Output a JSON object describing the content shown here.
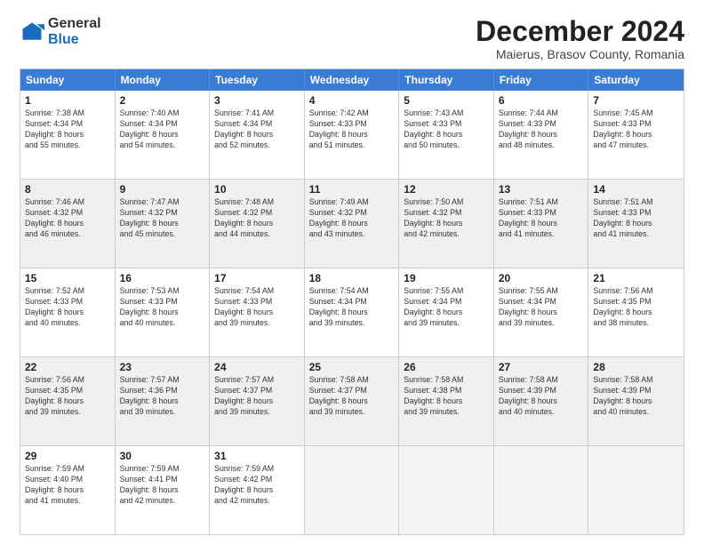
{
  "logo": {
    "general": "General",
    "blue": "Blue"
  },
  "header": {
    "month": "December 2024",
    "location": "Maierus, Brasov County, Romania"
  },
  "days": [
    "Sunday",
    "Monday",
    "Tuesday",
    "Wednesday",
    "Thursday",
    "Friday",
    "Saturday"
  ],
  "rows": [
    [
      {
        "day": "1",
        "lines": [
          "Sunrise: 7:38 AM",
          "Sunset: 4:34 PM",
          "Daylight: 8 hours",
          "and 55 minutes."
        ]
      },
      {
        "day": "2",
        "lines": [
          "Sunrise: 7:40 AM",
          "Sunset: 4:34 PM",
          "Daylight: 8 hours",
          "and 54 minutes."
        ]
      },
      {
        "day": "3",
        "lines": [
          "Sunrise: 7:41 AM",
          "Sunset: 4:34 PM",
          "Daylight: 8 hours",
          "and 52 minutes."
        ]
      },
      {
        "day": "4",
        "lines": [
          "Sunrise: 7:42 AM",
          "Sunset: 4:33 PM",
          "Daylight: 8 hours",
          "and 51 minutes."
        ]
      },
      {
        "day": "5",
        "lines": [
          "Sunrise: 7:43 AM",
          "Sunset: 4:33 PM",
          "Daylight: 8 hours",
          "and 50 minutes."
        ]
      },
      {
        "day": "6",
        "lines": [
          "Sunrise: 7:44 AM",
          "Sunset: 4:33 PM",
          "Daylight: 8 hours",
          "and 48 minutes."
        ]
      },
      {
        "day": "7",
        "lines": [
          "Sunrise: 7:45 AM",
          "Sunset: 4:33 PM",
          "Daylight: 8 hours",
          "and 47 minutes."
        ]
      }
    ],
    [
      {
        "day": "8",
        "lines": [
          "Sunrise: 7:46 AM",
          "Sunset: 4:32 PM",
          "Daylight: 8 hours",
          "and 46 minutes."
        ]
      },
      {
        "day": "9",
        "lines": [
          "Sunrise: 7:47 AM",
          "Sunset: 4:32 PM",
          "Daylight: 8 hours",
          "and 45 minutes."
        ]
      },
      {
        "day": "10",
        "lines": [
          "Sunrise: 7:48 AM",
          "Sunset: 4:32 PM",
          "Daylight: 8 hours",
          "and 44 minutes."
        ]
      },
      {
        "day": "11",
        "lines": [
          "Sunrise: 7:49 AM",
          "Sunset: 4:32 PM",
          "Daylight: 8 hours",
          "and 43 minutes."
        ]
      },
      {
        "day": "12",
        "lines": [
          "Sunrise: 7:50 AM",
          "Sunset: 4:32 PM",
          "Daylight: 8 hours",
          "and 42 minutes."
        ]
      },
      {
        "day": "13",
        "lines": [
          "Sunrise: 7:51 AM",
          "Sunset: 4:33 PM",
          "Daylight: 8 hours",
          "and 41 minutes."
        ]
      },
      {
        "day": "14",
        "lines": [
          "Sunrise: 7:51 AM",
          "Sunset: 4:33 PM",
          "Daylight: 8 hours",
          "and 41 minutes."
        ]
      }
    ],
    [
      {
        "day": "15",
        "lines": [
          "Sunrise: 7:52 AM",
          "Sunset: 4:33 PM",
          "Daylight: 8 hours",
          "and 40 minutes."
        ]
      },
      {
        "day": "16",
        "lines": [
          "Sunrise: 7:53 AM",
          "Sunset: 4:33 PM",
          "Daylight: 8 hours",
          "and 40 minutes."
        ]
      },
      {
        "day": "17",
        "lines": [
          "Sunrise: 7:54 AM",
          "Sunset: 4:33 PM",
          "Daylight: 8 hours",
          "and 39 minutes."
        ]
      },
      {
        "day": "18",
        "lines": [
          "Sunrise: 7:54 AM",
          "Sunset: 4:34 PM",
          "Daylight: 8 hours",
          "and 39 minutes."
        ]
      },
      {
        "day": "19",
        "lines": [
          "Sunrise: 7:55 AM",
          "Sunset: 4:34 PM",
          "Daylight: 8 hours",
          "and 39 minutes."
        ]
      },
      {
        "day": "20",
        "lines": [
          "Sunrise: 7:55 AM",
          "Sunset: 4:34 PM",
          "Daylight: 8 hours",
          "and 39 minutes."
        ]
      },
      {
        "day": "21",
        "lines": [
          "Sunrise: 7:56 AM",
          "Sunset: 4:35 PM",
          "Daylight: 8 hours",
          "and 38 minutes."
        ]
      }
    ],
    [
      {
        "day": "22",
        "lines": [
          "Sunrise: 7:56 AM",
          "Sunset: 4:35 PM",
          "Daylight: 8 hours",
          "and 39 minutes."
        ]
      },
      {
        "day": "23",
        "lines": [
          "Sunrise: 7:57 AM",
          "Sunset: 4:36 PM",
          "Daylight: 8 hours",
          "and 39 minutes."
        ]
      },
      {
        "day": "24",
        "lines": [
          "Sunrise: 7:57 AM",
          "Sunset: 4:37 PM",
          "Daylight: 8 hours",
          "and 39 minutes."
        ]
      },
      {
        "day": "25",
        "lines": [
          "Sunrise: 7:58 AM",
          "Sunset: 4:37 PM",
          "Daylight: 8 hours",
          "and 39 minutes."
        ]
      },
      {
        "day": "26",
        "lines": [
          "Sunrise: 7:58 AM",
          "Sunset: 4:38 PM",
          "Daylight: 8 hours",
          "and 39 minutes."
        ]
      },
      {
        "day": "27",
        "lines": [
          "Sunrise: 7:58 AM",
          "Sunset: 4:39 PM",
          "Daylight: 8 hours",
          "and 40 minutes."
        ]
      },
      {
        "day": "28",
        "lines": [
          "Sunrise: 7:58 AM",
          "Sunset: 4:39 PM",
          "Daylight: 8 hours",
          "and 40 minutes."
        ]
      }
    ],
    [
      {
        "day": "29",
        "lines": [
          "Sunrise: 7:59 AM",
          "Sunset: 4:40 PM",
          "Daylight: 8 hours",
          "and 41 minutes."
        ]
      },
      {
        "day": "30",
        "lines": [
          "Sunrise: 7:59 AM",
          "Sunset: 4:41 PM",
          "Daylight: 8 hours",
          "and 42 minutes."
        ]
      },
      {
        "day": "31",
        "lines": [
          "Sunrise: 7:59 AM",
          "Sunset: 4:42 PM",
          "Daylight: 8 hours",
          "and 42 minutes."
        ]
      },
      {
        "day": "",
        "lines": []
      },
      {
        "day": "",
        "lines": []
      },
      {
        "day": "",
        "lines": []
      },
      {
        "day": "",
        "lines": []
      }
    ]
  ]
}
